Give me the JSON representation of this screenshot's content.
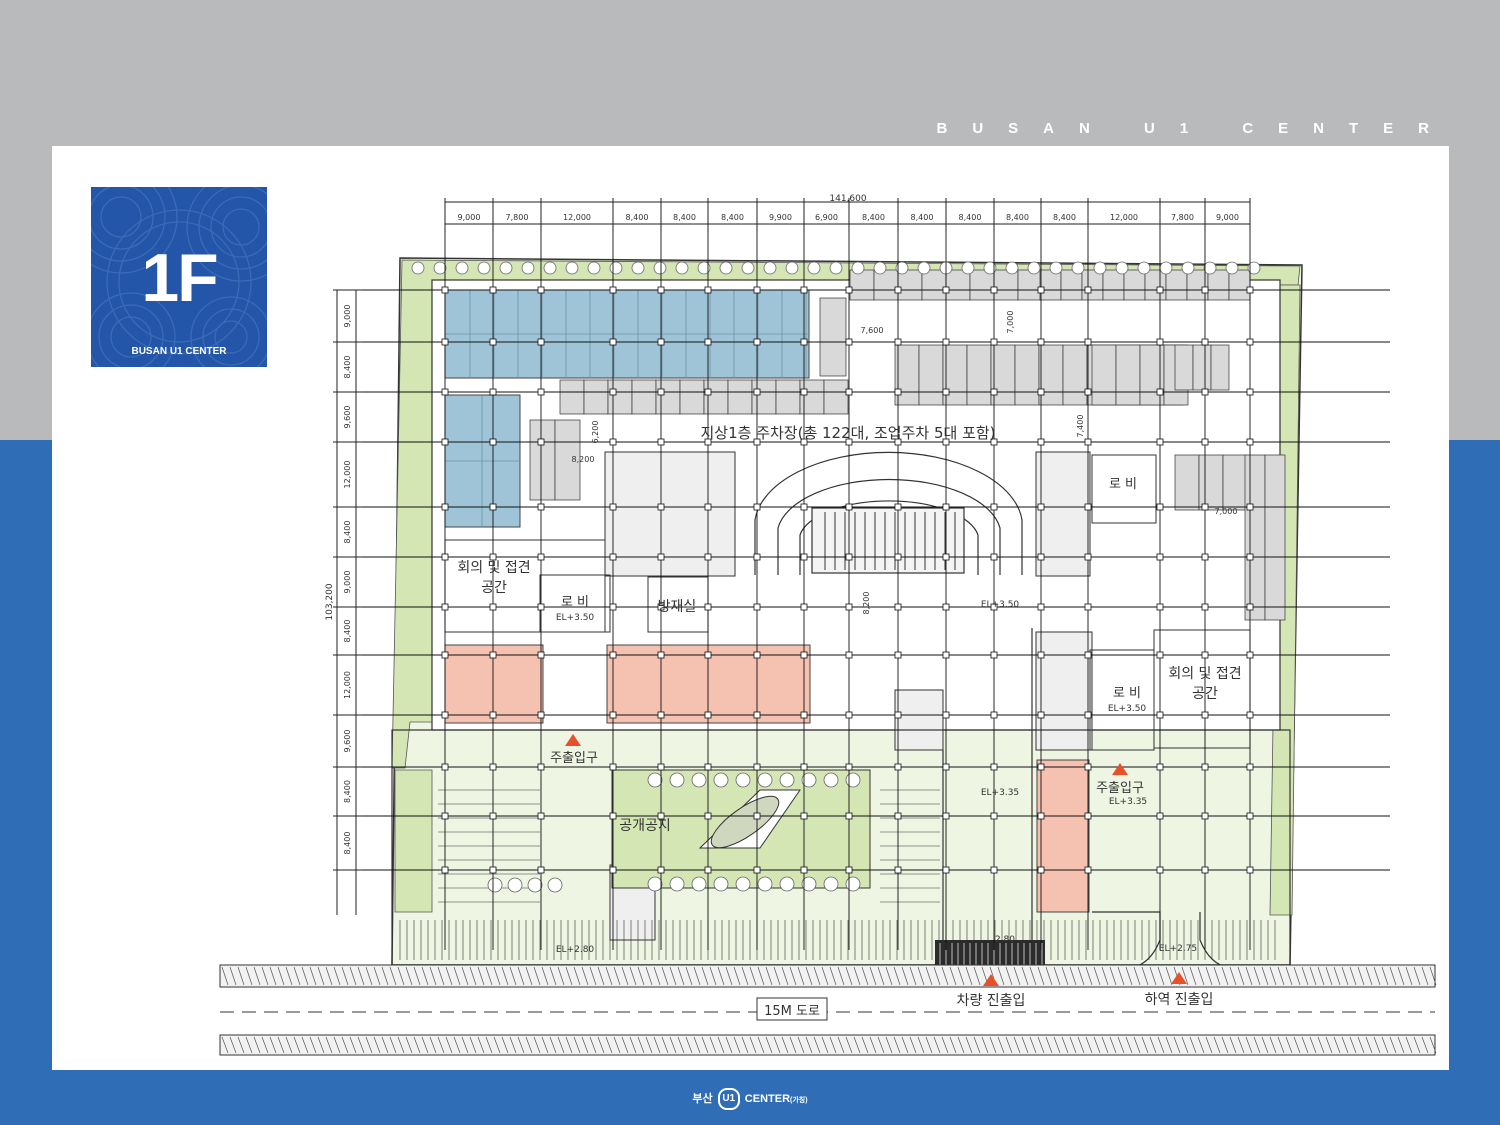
{
  "header": {
    "brand": "BUSAN U1 CENTER"
  },
  "badge": {
    "floor": "1F",
    "subtitle": "BUSAN U1 CENTER"
  },
  "plan": {
    "overall_width": "141,600",
    "overall_depth": "103,200",
    "col_dims": [
      "9,000",
      "7,800",
      "12,000",
      "8,400",
      "8,400",
      "8,400",
      "9,900",
      "6,900",
      "8,400",
      "8,400",
      "8,400",
      "8,400",
      "8,400",
      "12,000",
      "7,800",
      "9,000"
    ],
    "row_dims": [
      "9,000",
      "8,400",
      "9,600",
      "12,000",
      "8,400",
      "9,000",
      "8,400",
      "12,000",
      "9,600",
      "8,400",
      "8,400"
    ],
    "inner_dims": {
      "d1": "7,600",
      "d2": "7,000",
      "d3": "6,200",
      "d4": "8,200",
      "d5": "7,400",
      "d6": "7,000",
      "d7": "8,200"
    },
    "labels": {
      "parking": "지상1층 주차장(총 122대, 조업주차 5대 포함)",
      "meeting_left": "회의 및 접견",
      "meeting_left_2": "공간",
      "lobby_left": "로 비",
      "lobby_left_el": "EL+3.50",
      "disaster_room": "방재실",
      "lobby_right_top": "로 비",
      "meeting_right": "회의 및 접견",
      "meeting_right_2": "공간",
      "lobby_right": "로 비",
      "lobby_right_el": "EL+3.50",
      "main_entrance_left": "주출입구",
      "main_entrance_right": "주출입구",
      "main_entrance_right_el": "EL+3.35",
      "open_space": "공개공지",
      "el_center": "EL+3.50",
      "el_mid": "EL+3.35",
      "el_low_left": "EL+2.80",
      "el_low_center": "2.80",
      "el_low_right": "EL+2.75",
      "vehicle_entrance": "차량 진출입",
      "loading_entrance": "하역 진출입",
      "road": "15M 도로"
    }
  },
  "colors": {
    "top_bg": "#b9babc",
    "bottom_bg": "#2f6eb7",
    "badge": "#2356a8",
    "office": "#9fc4d8",
    "retail": "#f5c1b0",
    "green": "#d5e6b5",
    "arrow": "#e8502a"
  },
  "footer": {
    "prefix": "부산",
    "logo": "U1",
    "name": "CENTER",
    "suffix": "(가칭)"
  }
}
